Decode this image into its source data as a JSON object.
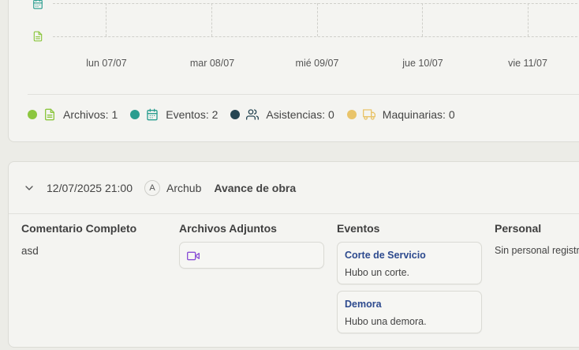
{
  "timeline": {
    "days": [
      "lun 07/07",
      "mar 08/07",
      "mié 09/07",
      "jue 10/07",
      "vie 11/07"
    ],
    "row_icons": [
      "calendar-icon",
      "file-icon"
    ]
  },
  "legend": [
    {
      "label": "Archivos: 1",
      "dot_color": "#8cc63f",
      "icon": "file-icon",
      "icon_color": "#8cc63f"
    },
    {
      "label": "Eventos: 2",
      "dot_color": "#2a9d8f",
      "icon": "calendar-icon",
      "icon_color": "#2a9d8f"
    },
    {
      "label": "Asistencias: 0",
      "dot_color": "#264653",
      "icon": "users-icon",
      "icon_color": "#264653"
    },
    {
      "label": "Maquinarias: 0",
      "dot_color": "#e9c46a",
      "icon": "truck-icon",
      "icon_color": "#e9c46a"
    }
  ],
  "entry": {
    "datetime": "12/07/2025 21:00",
    "avatar_initial": "A",
    "author": "Archub",
    "title": "Avance de obra",
    "comment_header": "Comentario Completo",
    "comment": "asd",
    "attachments_header": "Archivos Adjuntos",
    "attachment_icon": "video-icon",
    "events_header": "Eventos",
    "events": [
      {
        "title": "Corte de Servicio",
        "description": "Hubo un corte."
      },
      {
        "title": "Demora",
        "description": "Hubo una demora."
      }
    ],
    "personnel_header": "Personal",
    "personnel_text": "Sin personal registra"
  },
  "colors": {
    "accent_blue": "#2d4a8e",
    "video_purple": "#8a4fd6"
  }
}
